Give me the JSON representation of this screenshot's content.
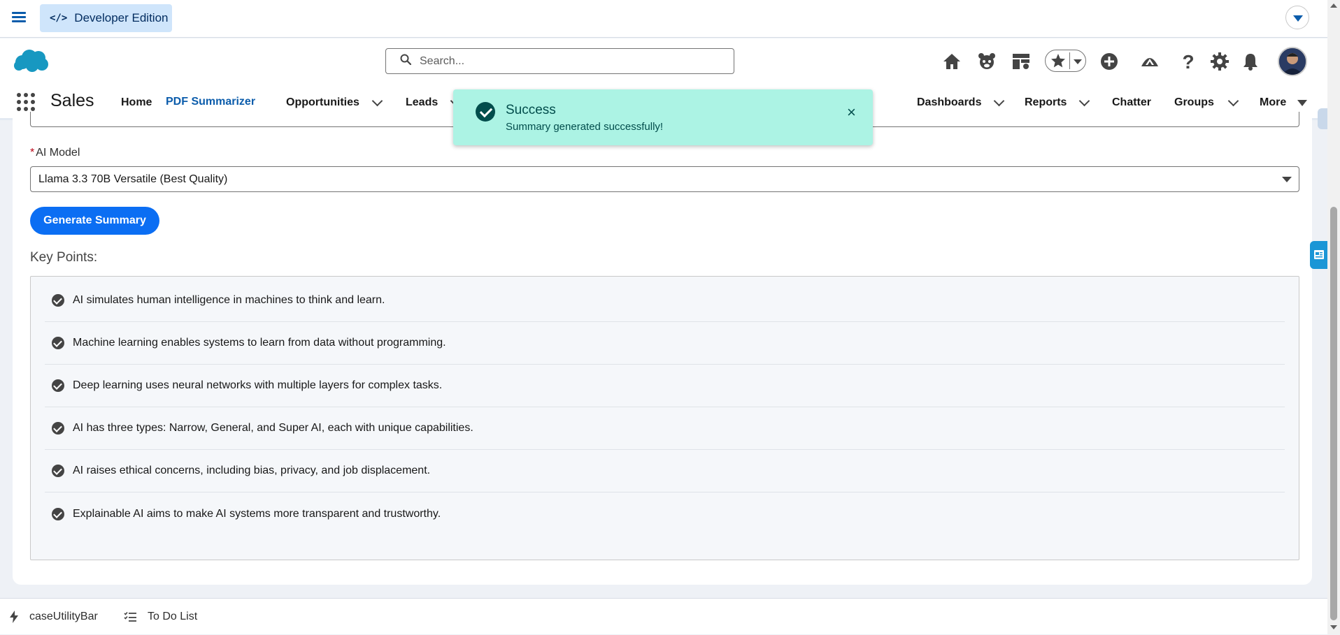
{
  "devbar": {
    "badge_label": "Developer Edition",
    "code_icon": "</>"
  },
  "search": {
    "placeholder": "Search..."
  },
  "header_icons": [
    "home-icon",
    "einstein-icon",
    "setup-assistant-icon",
    "favorites-icon",
    "add-icon",
    "trailhead-icon",
    "help-icon",
    "settings-icon",
    "notifications-icon"
  ],
  "nav": {
    "app_name": "Sales",
    "items": [
      {
        "label": "Home"
      },
      {
        "label": "PDF Summarizer",
        "active": true
      },
      {
        "label": "Opportunities"
      },
      {
        "label": "Leads"
      },
      {
        "label": "Dashboards"
      },
      {
        "label": "Reports"
      },
      {
        "label": "Chatter"
      },
      {
        "label": "Groups"
      },
      {
        "label": "More"
      }
    ]
  },
  "toast": {
    "title": "Success",
    "message": "Summary generated successfully!",
    "close": "×",
    "color": "#acf3e4"
  },
  "form": {
    "required_marker": "*",
    "model_label": "AI Model",
    "model_value": "Llama 3.3 70B Versatile (Best Quality)",
    "generate_button": "Generate Summary"
  },
  "key_points": {
    "title": "Key Points:",
    "items": [
      "AI simulates human intelligence in machines to think and learn.",
      "Machine learning enables systems to learn from data without programming.",
      "Deep learning uses neural networks with multiple layers for complex tasks.",
      "AI has three types: Narrow, General, and Super AI, each with unique capabilities.",
      "AI raises ethical concerns, including bias, privacy, and job displacement.",
      "Explainable AI aims to make AI systems more transparent and trustworthy."
    ]
  },
  "utility_bar": {
    "items": [
      {
        "label": "caseUtilityBar",
        "icon": "lightning-icon"
      },
      {
        "label": "To Do List",
        "icon": "checklist-icon"
      }
    ]
  },
  "colors": {
    "brand": "#0b5cab",
    "button": "#0b6ef3",
    "toast_bg": "#acf3e4",
    "toast_text": "#024d4c"
  }
}
